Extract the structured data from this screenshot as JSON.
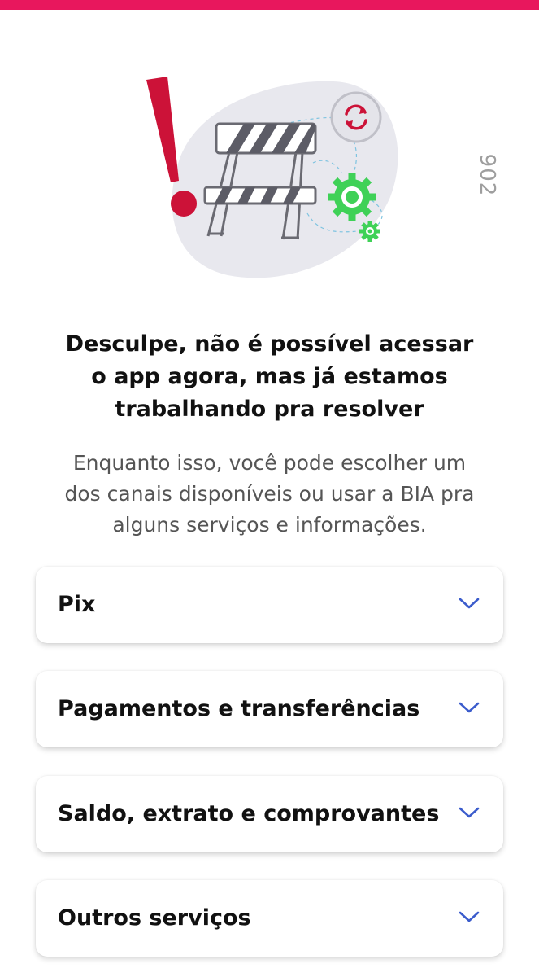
{
  "colors": {
    "top_bar": "#e8175d",
    "accent_red": "#cc1238",
    "chevron": "#3b5ccc",
    "gear_green": "#3fd157",
    "blob": "#e8e8ee"
  },
  "error_code": "902",
  "message": {
    "title_lines": [
      "Desculpe, não é possível acessar",
      "o app agora, mas já estamos",
      "trabalhando pra resolver"
    ],
    "subtitle_lines": [
      "Enquanto isso, você pode escolher um",
      "dos canais disponíveis ou usar a BIA pra",
      "alguns serviços e informações."
    ]
  },
  "help_topics": [
    {
      "label": "Pix",
      "icon": "chevron-down-icon"
    },
    {
      "label": "Pagamentos e transferências",
      "icon": "chevron-down-icon"
    },
    {
      "label": "Saldo, extrato e comprovantes",
      "icon": "chevron-down-icon"
    },
    {
      "label": "Outros serviços",
      "icon": "chevron-down-icon"
    }
  ]
}
